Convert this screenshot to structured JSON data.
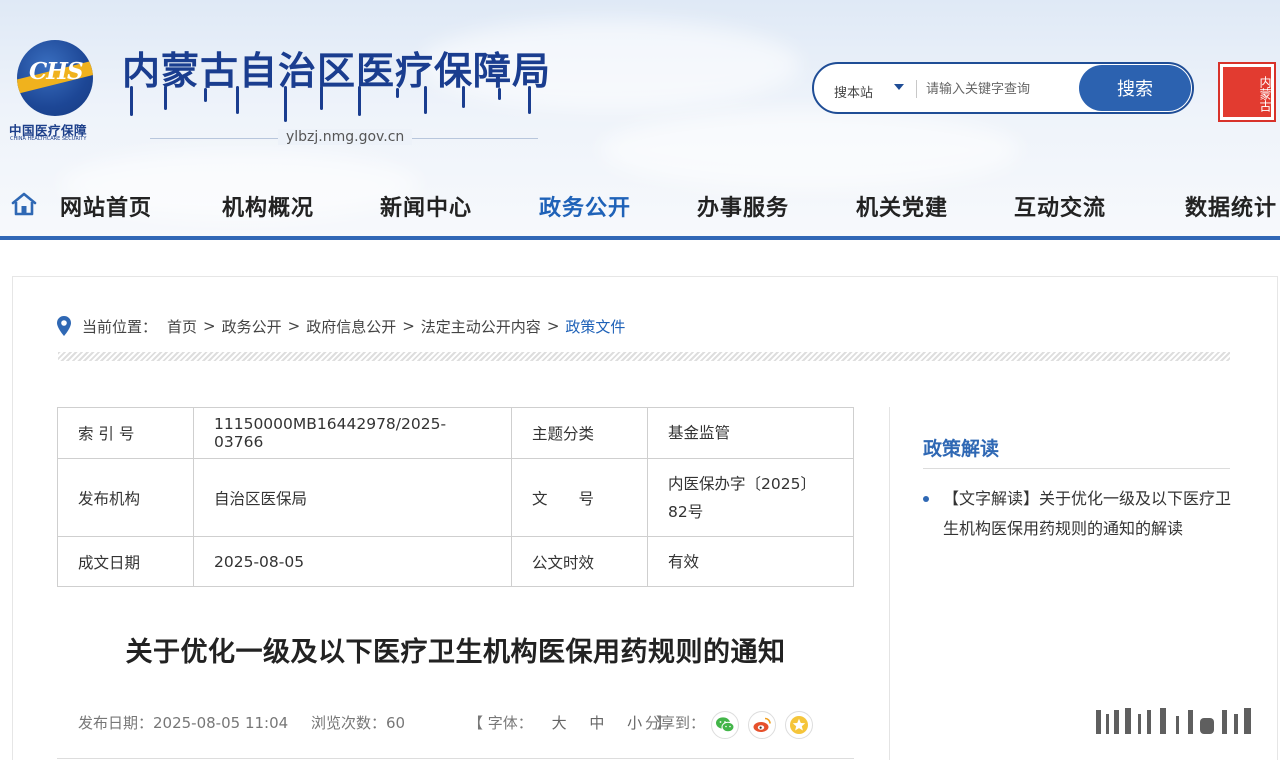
{
  "header": {
    "logo_cn": "中国医疗保障",
    "logo_en": "CHINA HEALTHCARE SECURITY",
    "logo_mark": "CHS",
    "site_title": "内蒙古自治区医疗保障局",
    "domain": "ylbzj.nmg.gov.cn",
    "seal_text": "内蒙古"
  },
  "search": {
    "scope": "搜本站",
    "placeholder": "请输入关键字查询",
    "button": "搜索"
  },
  "nav": {
    "items": [
      "网站首页",
      "机构概况",
      "新闻中心",
      "政务公开",
      "办事服务",
      "机关党建",
      "互动交流",
      "数据统计"
    ],
    "active": "政务公开"
  },
  "breadcrumb": {
    "label": "当前位置：",
    "items": [
      "首页",
      "政务公开",
      "政府信息公开",
      "法定主动公开内容",
      "政策文件"
    ],
    "separator": ">"
  },
  "meta": {
    "rows": [
      {
        "k1": "索 引 号",
        "v1": "11150000MB16442978/2025-03766",
        "k2": "主题分类",
        "v2": "基金监管"
      },
      {
        "k1": "发布机构",
        "v1": "自治区医保局",
        "k2": "文　　号",
        "v2": "内医保办字〔2025〕82号"
      },
      {
        "k1": "成文日期",
        "v1": "2025-08-05",
        "k2": "公文时效",
        "v2": "有效"
      }
    ]
  },
  "article": {
    "title": "关于优化一级及以下医疗卫生机构医保用药规则的通知",
    "publish_date": "发布日期：2025-08-05 11:04",
    "views": "浏览次数：60",
    "font_label": "【 字体：",
    "font_sizes": [
      "大",
      "中",
      "小"
    ],
    "font_close": "】",
    "share_label": "分享到："
  },
  "sidebar": {
    "title": "政策解读",
    "items": [
      "【文字解读】关于优化一级及以下医疗卫生机构医保用药规则的通知的解读"
    ]
  },
  "colors": {
    "brand_blue": "#1a3d8f",
    "nav_active": "#1f62b8",
    "nav_bar": "#3167b6",
    "search_button": "#2c62b0",
    "seal_red": "#e23b30"
  },
  "icons": {
    "home": "home-icon",
    "location": "location-pin-icon",
    "share": [
      "wechat-icon",
      "weibo-icon",
      "favorite-star-icon"
    ]
  }
}
